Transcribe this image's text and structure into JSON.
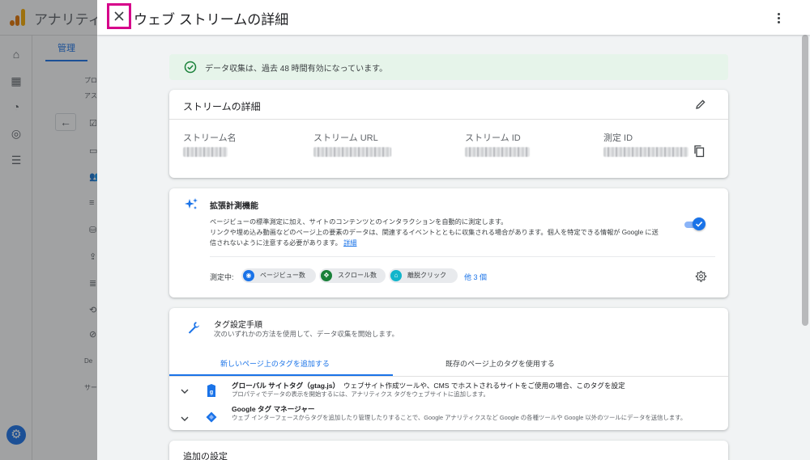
{
  "background": {
    "app_name": "アナリティ",
    "admin_tab": "管理",
    "snippets": [
      "プロ",
      "アス",
      "De",
      "サー"
    ]
  },
  "panel": {
    "title": "ウェブ ストリームの詳細"
  },
  "banner": {
    "text": "データ収集は、過去 48 時間有効になっています。"
  },
  "stream_details": {
    "title": "ストリームの詳細",
    "columns": [
      {
        "label": "ストリーム名"
      },
      {
        "label": "ストリーム URL"
      },
      {
        "label": "ストリーム ID"
      },
      {
        "label": "測定 ID"
      }
    ]
  },
  "enhanced_measurement": {
    "title": "拡張計測機能",
    "description_line1": "ページビューの標準測定に加え、サイトのコンテンツとのインタラクションを自動的に測定します。",
    "description_line2": "リンクや埋め込み動画などのページ上の要素のデータは、関連するイベントとともに収集される場合があります。個人を特定できる情報が Google に送",
    "description_line3": "信されないように注意する必要があります。",
    "details_link": "詳細",
    "measuring_label": "測定中:",
    "chips": [
      {
        "label": "ページビュー数",
        "icon": "eye-icon",
        "color": "#1a73e8"
      },
      {
        "label": "スクロール数",
        "icon": "crosshair-icon",
        "color": "#188038"
      },
      {
        "label": "離脱クリック",
        "icon": "mouse-icon",
        "color": "#12b5cb"
      }
    ],
    "more_link": "他 3 個",
    "toggle_on": true
  },
  "tagging": {
    "title": "タグ設定手順",
    "subtitle": "次のいずれかの方法を使用して、データ収集を開始します。",
    "tabs": [
      {
        "label": "新しいページ上のタグを追加する",
        "active": true
      },
      {
        "label": "既存のページ上のタグを使用する",
        "active": false
      }
    ],
    "options": [
      {
        "title": "グローバル サイトタグ（gtag.js）",
        "title_suffix": "ウェブサイト作成ツールや、CMS でホストされるサイトをご使用の場合、このタグを設定",
        "description": "プロパティでデータの表示を開始するには、アナリティクス タグをウェブサイトに追加します。"
      },
      {
        "title": "Google タグ マネージャー",
        "title_suffix": "",
        "description": "ウェブ インターフェースからタグを追加したり管理したりすることで、Google アナリティクスなど Google の各種ツールや Google 以外のツールにデータを送信します。"
      }
    ]
  },
  "additional": {
    "title": "追加の設定"
  },
  "colors": {
    "accent": "#1a73e8",
    "highlight_box": "#d6008a",
    "banner_bg": "#e6f4ea",
    "success": "#188038"
  }
}
